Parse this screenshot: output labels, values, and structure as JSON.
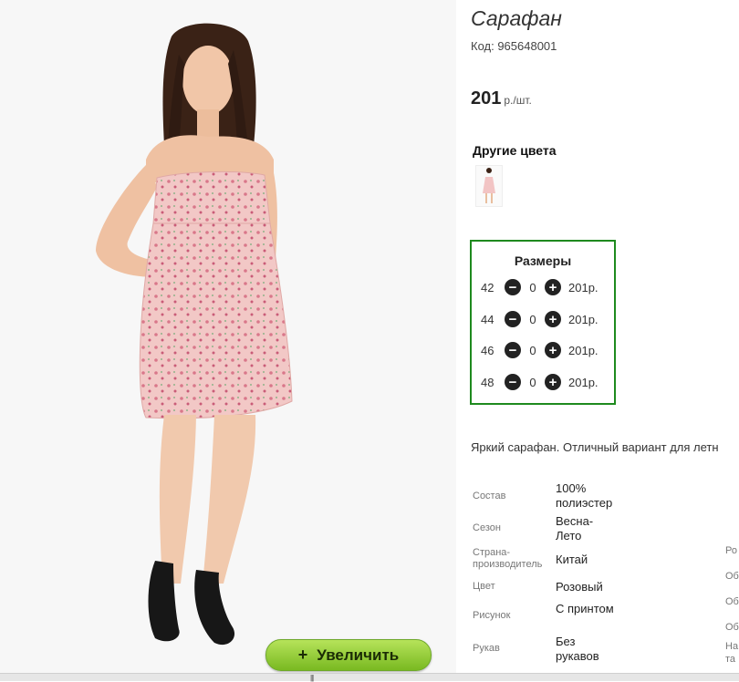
{
  "product": {
    "title": "Сарафан",
    "code": "Код: 965648001",
    "price": "201",
    "price_unit": "р./шт."
  },
  "zoom_button": {
    "plus": "+",
    "label": "Увеличить"
  },
  "other_colors": {
    "title": "Другие цвета"
  },
  "sizes": {
    "title": "Размеры",
    "rows": [
      {
        "size": "42",
        "qty": "0",
        "price": "201р."
      },
      {
        "size": "44",
        "qty": "0",
        "price": "201р."
      },
      {
        "size": "46",
        "qty": "0",
        "price": "201р."
      },
      {
        "size": "48",
        "qty": "0",
        "price": "201р."
      }
    ]
  },
  "description": "Яркий сарафан. Отличный вариант для летн",
  "attributes": [
    {
      "label": "Состав",
      "value": "100% полиэстер"
    },
    {
      "label": "Сезон",
      "value": "Весна-Лето"
    },
    {
      "label": "Страна-производитель",
      "value": "Китай"
    },
    {
      "label": "Цвет",
      "value": "Розовый"
    },
    {
      "label": "Рисунок",
      "value": "С принтом"
    },
    {
      "label": "Рукав",
      "value": "Без рукавов"
    }
  ],
  "edge_labels": [
    "Ро",
    "Об",
    "Об",
    "Об",
    "На",
    "та"
  ],
  "colors": {
    "border_green": "#1e8a1e",
    "button_green": "#8cc63f",
    "dress_pink": "#f2c4c4"
  }
}
